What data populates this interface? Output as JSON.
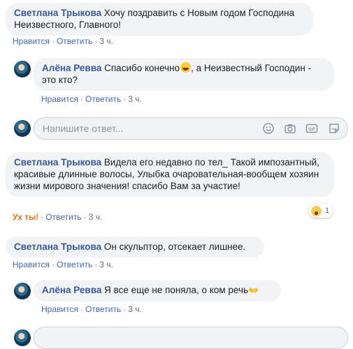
{
  "comments": [
    {
      "author": "Светлана Трыкова",
      "text": "Хочу поздравить с Новым годом Господина Неизвестного, Главного!",
      "actions": {
        "like": "Нравится",
        "reply": "Ответить",
        "time": "3 ч."
      }
    },
    {
      "author": "Алёна Ревва",
      "text_a": "Спасибо конечно",
      "text_b": ", а Неизвестный Господин - это кто?",
      "actions": {
        "like": "Нравится",
        "reply": "Ответить",
        "time": "3 ч."
      }
    },
    {
      "author": "Светлана Трыкова",
      "text": "Видела его недавно по тел_ Такой импозантный, красивые длинные волосы, Улыбка очаровательная-вообщем хозяин жизни мирового значения! спасибо Вам за участие!",
      "actions": {
        "like": "Ух ты!",
        "reply": "Ответить",
        "time": "3 ч."
      },
      "reaction": {
        "icon": "wow-emoji-icon",
        "count": "1"
      }
    },
    {
      "author": "Светлана Трыкова",
      "text": "Он скульптор, отсекает лишнее.",
      "actions": {
        "like": "Нравится",
        "reply": "Ответить",
        "time": "3 ч."
      }
    },
    {
      "author": "Алёна Ревва",
      "text": "Я все еще не поняла, о ком речь",
      "actions": {
        "like": "Нравится",
        "reply": "Ответить",
        "time": "3 ч."
      }
    }
  ],
  "reply_box": {
    "placeholder": "Напишите ответ...",
    "tools": [
      "emoji-icon",
      "camera-icon",
      "gif-icon",
      "sticker-icon"
    ]
  },
  "colors": {
    "author": "#385898",
    "link": "#4267b2",
    "reacted": "#e9710f",
    "bubble": "#f2f3f5"
  }
}
